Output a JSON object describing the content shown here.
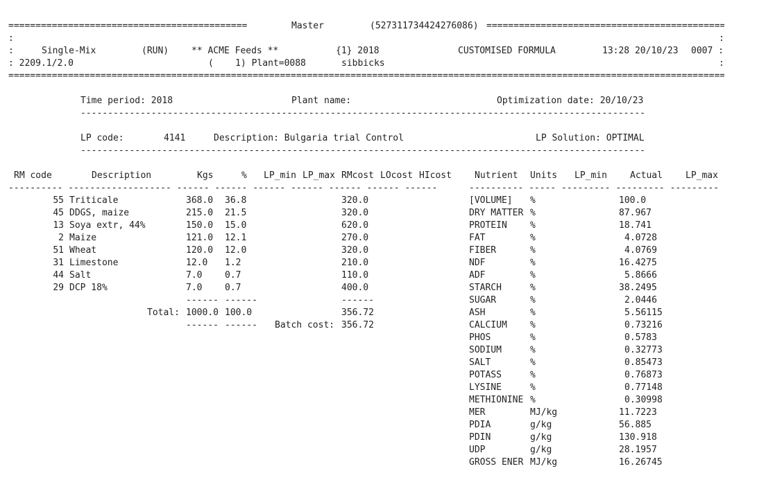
{
  "header": {
    "rule": "==========================================================================================================================================",
    "master_label": "Master",
    "master_id": "(527311734424276086)",
    "colon": ":",
    "mix_type": "Single-Mix",
    "run_state": "(RUN)",
    "company": "** ACME Feeds **",
    "period_code": "{1} 2018",
    "formula_type": "CUSTOMISED FORMULA",
    "datetime": "13:28 20/10/23",
    "seq": "0007 :",
    "version_line": ": 2209.1/2.0",
    "plant_line": "(    1) Plant=0088",
    "product": "sibbicks"
  },
  "summary": {
    "time_period": "Time period: 2018",
    "plant_name": "Plant name:",
    "optimization_date": "Optimization date: 20/10/23",
    "dash_rule": "---------------------------------------------------------------------------------------------------------------",
    "lp_code_label": "LP code:",
    "lp_code": "4141",
    "description": "Description: Bulgaria trial Control",
    "lp_solution": "LP Solution: OPTIMAL"
  },
  "rm_table": {
    "headers": {
      "code": "RM code",
      "desc": "Description",
      "kgs": "Kgs",
      "pct": "%",
      "lpmin": "LP_min",
      "lpmax": "LP_max",
      "rmcost": "RMcost",
      "locost": "LOcost",
      "hicost": "HIcost"
    },
    "header_rule": "---------- ------------------- ------ ------ ------ ------ ------ ------ ------",
    "rows": [
      {
        "code": "55",
        "desc": "Triticale",
        "kgs": "368.0",
        "pct": "36.8",
        "rmcost": "320.0"
      },
      {
        "code": "45",
        "desc": "DDGS, maize",
        "kgs": "215.0",
        "pct": "21.5",
        "rmcost": "320.0"
      },
      {
        "code": "13",
        "desc": "Soya extr, 44%",
        "kgs": "150.0",
        "pct": "15.0",
        "rmcost": "620.0"
      },
      {
        "code": "2",
        "desc": "Maize",
        "kgs": "121.0",
        "pct": "12.1",
        "rmcost": "270.0"
      },
      {
        "code": "51",
        "desc": "Wheat",
        "kgs": "120.0",
        "pct": "12.0",
        "rmcost": "320.0"
      },
      {
        "code": "31",
        "desc": "Limestone",
        "kgs": "12.0",
        "pct": "1.2",
        "rmcost": "210.0"
      },
      {
        "code": "44",
        "desc": "Salt",
        "kgs": "7.0",
        "pct": "0.7",
        "rmcost": "110.0"
      },
      {
        "code": "29",
        "desc": "DCP 18%",
        "kgs": "7.0",
        "pct": "0.7",
        "rmcost": "400.0"
      }
    ],
    "sub_rule_kgs": "------",
    "sub_rule_pct": "------",
    "sub_rule_cost": "------",
    "total_label": "Total:",
    "total_kgs": "1000.0",
    "total_pct": "100.0",
    "total_cost": "356.72",
    "batch_cost_label": "Batch cost:",
    "batch_cost": "356.72"
  },
  "nutrient_table": {
    "headers": {
      "nutrient": "Nutrient",
      "units": "Units",
      "lpmin": "LP_min",
      "actual": "Actual",
      "lpmax": "LP_max"
    },
    "header_rule": "---------- ----- --------- --------- ---------",
    "rows": [
      {
        "name": "[VOLUME]",
        "units": "%",
        "actual": "100.0"
      },
      {
        "name": "DRY MATTER",
        "units": "%",
        "actual": "87.967"
      },
      {
        "name": "PROTEIN",
        "units": "%",
        "actual": "18.741"
      },
      {
        "name": "FAT",
        "units": "%",
        "actual": "4.0728"
      },
      {
        "name": "FIBER",
        "units": "%",
        "actual": "4.0769"
      },
      {
        "name": "NDF",
        "units": "%",
        "actual": "16.4275"
      },
      {
        "name": "ADF",
        "units": "%",
        "actual": "5.8666"
      },
      {
        "name": "STARCH",
        "units": "%",
        "actual": "38.2495"
      },
      {
        "name": "SUGAR",
        "units": "%",
        "actual": "2.0446"
      },
      {
        "name": "ASH",
        "units": "%",
        "actual": "5.56115"
      },
      {
        "name": "CALCIUM",
        "units": "%",
        "actual": "0.73216"
      },
      {
        "name": "PHOS",
        "units": "%",
        "actual": "0.5783"
      },
      {
        "name": "SODIUM",
        "units": "%",
        "actual": "0.32773"
      },
      {
        "name": "SALT",
        "units": "%",
        "actual": "0.85473"
      },
      {
        "name": "POTASS",
        "units": "%",
        "actual": "0.76873"
      },
      {
        "name": "LYSINE",
        "units": "%",
        "actual": "0.77148"
      },
      {
        "name": "METHIONINE",
        "units": "%",
        "actual": "0.30998"
      },
      {
        "name": "MER",
        "units": "MJ/kg",
        "actual": "11.7223"
      },
      {
        "name": "PDIA",
        "units": "g/kg",
        "actual": "56.885"
      },
      {
        "name": "PDIN",
        "units": "g/kg",
        "actual": "130.918"
      },
      {
        "name": "UDP",
        "units": "g/kg",
        "actual": "28.1957"
      },
      {
        "name": "GROSS ENER",
        "units": "MJ/kg",
        "actual": "16.26745"
      }
    ]
  }
}
